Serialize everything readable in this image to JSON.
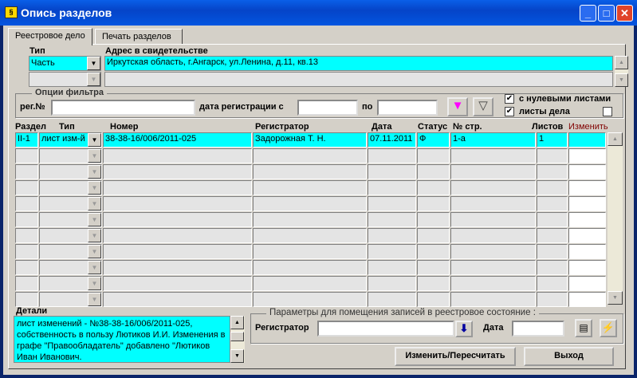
{
  "window": {
    "title": "Опись разделов",
    "icon": "app-icon",
    "buttons": [
      "minimize",
      "maximize",
      "close"
    ]
  },
  "tabs": [
    {
      "label": "Реестровое дело",
      "active": true
    },
    {
      "label": "Печать разделов",
      "active": false
    }
  ],
  "header": {
    "type_label": "Тип",
    "type_value": "Часть",
    "address_label": "Адрес в свидетельстве",
    "address_value": "Иркутская область, г.Ангарск, ул.Ленина, д.11, кв.13"
  },
  "filter": {
    "group_label": "Опции фильтра",
    "reg_label": "рег.№",
    "reg_value": "",
    "date_from_label": "дата регистрации с",
    "date_from_value": "",
    "date_to_label": "по",
    "date_to_value": "",
    "zero_sheets_label": "с нулевыми листами",
    "zero_sheets_checked": true,
    "case_sheets_label": "листы дела",
    "case_sheets_checked": true,
    "extra_checked": false
  },
  "table": {
    "columns": [
      "Раздел",
      "Тип",
      "Номер",
      "Регистратор",
      "Дата",
      "Статус",
      "№ стр.",
      "Листов",
      "Изменить"
    ],
    "rows": [
      {
        "section": "II-1",
        "type": "лист изм-й",
        "number": "38-38-16/006/2011-025",
        "registrar": "Задорожная Т. Н.",
        "date": "07.11.2011",
        "status": "Ф",
        "page": "1-а",
        "sheets": "1",
        "change": ""
      }
    ],
    "empty_rows": 10
  },
  "details": {
    "label": "Детали",
    "text": "лист изменений - №38-38-16/006/2011-025, собственность в пользу Лютиков И.И. Изменения в графе \"Правообладатель\" добавлено \"Лютиков Иван Иванович."
  },
  "params": {
    "group_label": "Параметры для помещения записей в реестровое состояние :",
    "registrar_label": "Регистратор",
    "registrar_value": "",
    "date_label": "Дата",
    "date_value": ""
  },
  "buttons": {
    "recalc": "Изменить/Пересчитать",
    "exit": "Выход"
  },
  "colors": {
    "highlight": "#00ffff",
    "change_header": "#800000"
  }
}
